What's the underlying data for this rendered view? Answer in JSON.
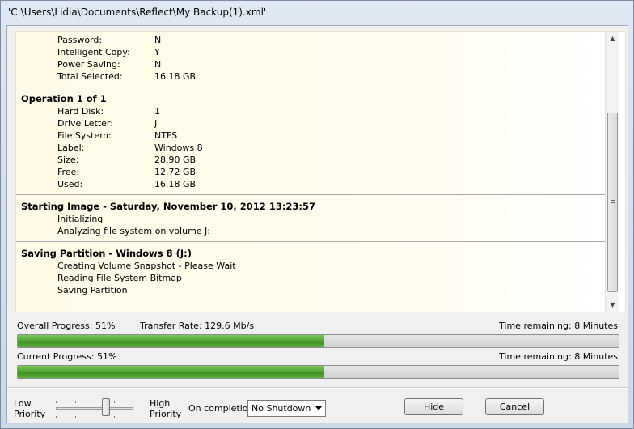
{
  "window": {
    "title": "'C:\\Users\\Lidia\\Documents\\Reflect\\My Backup(1).xml'"
  },
  "log": {
    "summary": [
      {
        "key": "Password:",
        "value": "N"
      },
      {
        "key": "Intelligent Copy:",
        "value": "Y"
      },
      {
        "key": "Power Saving:",
        "value": "N"
      },
      {
        "key": "Total Selected:",
        "value": "16.18 GB"
      }
    ],
    "operation": {
      "title": "Operation 1 of 1",
      "rows": [
        {
          "key": "Hard Disk:",
          "value": "1"
        },
        {
          "key": "Drive Letter:",
          "value": "J"
        },
        {
          "key": "File System:",
          "value": "NTFS"
        },
        {
          "key": "Label:",
          "value": "Windows 8"
        },
        {
          "key": "Size:",
          "value": "28.90 GB"
        },
        {
          "key": "Free:",
          "value": "12.72 GB"
        },
        {
          "key": "Used:",
          "value": "16.18 GB"
        }
      ]
    },
    "image": {
      "title": "Starting Image - Saturday, November 10, 2012 13:23:57",
      "lines": [
        "Initializing",
        "Analyzing file system on volume J:"
      ]
    },
    "partition": {
      "title": "Saving Partition - Windows 8 (J:)",
      "lines": [
        "Creating Volume Snapshot - Please Wait",
        "Reading File System Bitmap",
        "Saving Partition"
      ]
    }
  },
  "progress": {
    "overall_label": "Overall Progress:  51%",
    "overall_fraction": 0.51,
    "transfer_rate": "Transfer Rate: 129.6 Mb/s",
    "overall_time": "Time remaining: 8 Minutes",
    "current_label": "Current Progress:  51%",
    "current_fraction": 0.51,
    "current_time": "Time remaining: 8 Minutes"
  },
  "controls": {
    "low_priority": [
      "Low",
      "Priority"
    ],
    "high_priority": [
      "High",
      "Priority"
    ],
    "on_completion_label": "On completion",
    "on_completion_value": "No Shutdown",
    "hide_label": "Hide",
    "cancel_label": "Cancel"
  }
}
